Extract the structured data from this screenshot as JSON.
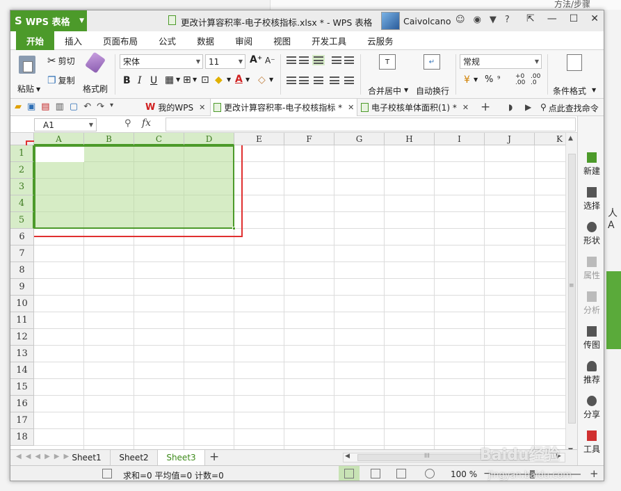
{
  "background": {
    "top_text": "方法/步骤",
    "side_char": "人A"
  },
  "titlebar": {
    "app_name": "WPS 表格",
    "app_logo": "S",
    "doc_title": "更改计算容积率-电子校核指标.xlsx * - WPS 表格",
    "username": "Caivolcano"
  },
  "menu_tabs": [
    "开始",
    "插入",
    "页面布局",
    "公式",
    "数据",
    "审阅",
    "视图",
    "开发工具",
    "云服务"
  ],
  "ribbon": {
    "paste": "粘贴",
    "cut": "剪切",
    "copy": "复制",
    "format_painter": "格式刷",
    "font_name": "宋体",
    "font_size": "11",
    "bold": "B",
    "italic": "I",
    "underline": "U",
    "merge_center": "合并居中",
    "wrap_text": "自动换行",
    "number_format": "常规",
    "percent": "%",
    "conditional_format": "条件格式"
  },
  "doc_tabs": [
    {
      "label": "我的WPS"
    },
    {
      "label": "更改计算容积率-电子校核指标 *"
    },
    {
      "label": "电子校核单体面积(1) *"
    }
  ],
  "search_cmd": "点此查找命令",
  "formula_bar": {
    "name_box": "A1",
    "fx": "fx"
  },
  "grid": {
    "columns": [
      "A",
      "B",
      "C",
      "D",
      "E",
      "F",
      "G",
      "H",
      "I",
      "J",
      "K"
    ],
    "rows": [
      "1",
      "2",
      "3",
      "4",
      "5",
      "6",
      "7",
      "8",
      "9",
      "10",
      "11",
      "12",
      "13",
      "14",
      "15",
      "16",
      "17",
      "18"
    ]
  },
  "side_panel": [
    "新建",
    "选择",
    "形状",
    "属性",
    "分析",
    "传图",
    "推荐",
    "分享",
    "工具"
  ],
  "sheets": [
    "Sheet1",
    "Sheet2",
    "Sheet3"
  ],
  "status": {
    "text": "求和=0  平均值=0  计数=0",
    "zoom": "100 %"
  },
  "watermark": {
    "text": "Baidu经验",
    "sub": "jingyan.baidu.com"
  },
  "colors": {
    "accent": "#4c9a2a",
    "selection": "#d7ecc8",
    "highlight_box": "#e03030"
  }
}
